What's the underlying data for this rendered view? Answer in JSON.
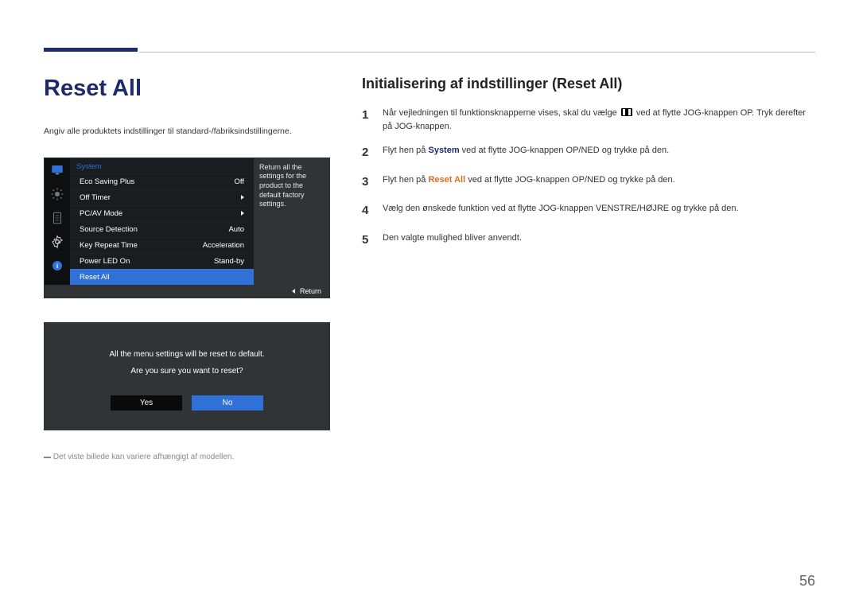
{
  "section_title": "Reset All",
  "intro": "Angiv alle produktets indstillinger til standard-/fabriksindstillingerne.",
  "osd": {
    "header": "System",
    "rows": [
      {
        "label": "Eco Saving Plus",
        "value": "Off",
        "arrow": false
      },
      {
        "label": "Off Timer",
        "value": "",
        "arrow": true
      },
      {
        "label": "PC/AV Mode",
        "value": "",
        "arrow": true
      },
      {
        "label": "Source Detection",
        "value": "Auto",
        "arrow": false
      },
      {
        "label": "Key Repeat Time",
        "value": "Acceleration",
        "arrow": false
      },
      {
        "label": "Power LED On",
        "value": "Stand-by",
        "arrow": false
      },
      {
        "label": "Reset All",
        "value": "",
        "arrow": false,
        "selected": true
      }
    ],
    "desc": "Return all the settings for the product to the default factory settings.",
    "footer_label": "Return"
  },
  "confirm": {
    "line1": "All the menu settings will be reset to default.",
    "line2": "Are you sure you want to reset?",
    "yes": "Yes",
    "no": "No"
  },
  "footnote": "Det viste billede kan variere afhængigt af modellen.",
  "right": {
    "title": "Initialisering af indstillinger (Reset All)",
    "steps": {
      "s1a": "Når vejledningen til funktionsknapperne vises, skal du vælge ",
      "s1b": " ved at flytte JOG-knappen OP. Tryk derefter på JOG-knappen.",
      "s2a": "Flyt hen på ",
      "s2b": "System",
      "s2c": " ved at flytte JOG-knappen OP/NED og trykke på den.",
      "s3a": "Flyt hen på ",
      "s3b": "Reset All",
      "s3c": " ved at flytte JOG-knappen OP/NED og trykke på den.",
      "s4": "Vælg den ønskede funktion ved at flytte JOG-knappen VENSTRE/HØJRE og trykke på den.",
      "s5": "Den valgte mulighed bliver anvendt."
    }
  },
  "page_number": "56"
}
